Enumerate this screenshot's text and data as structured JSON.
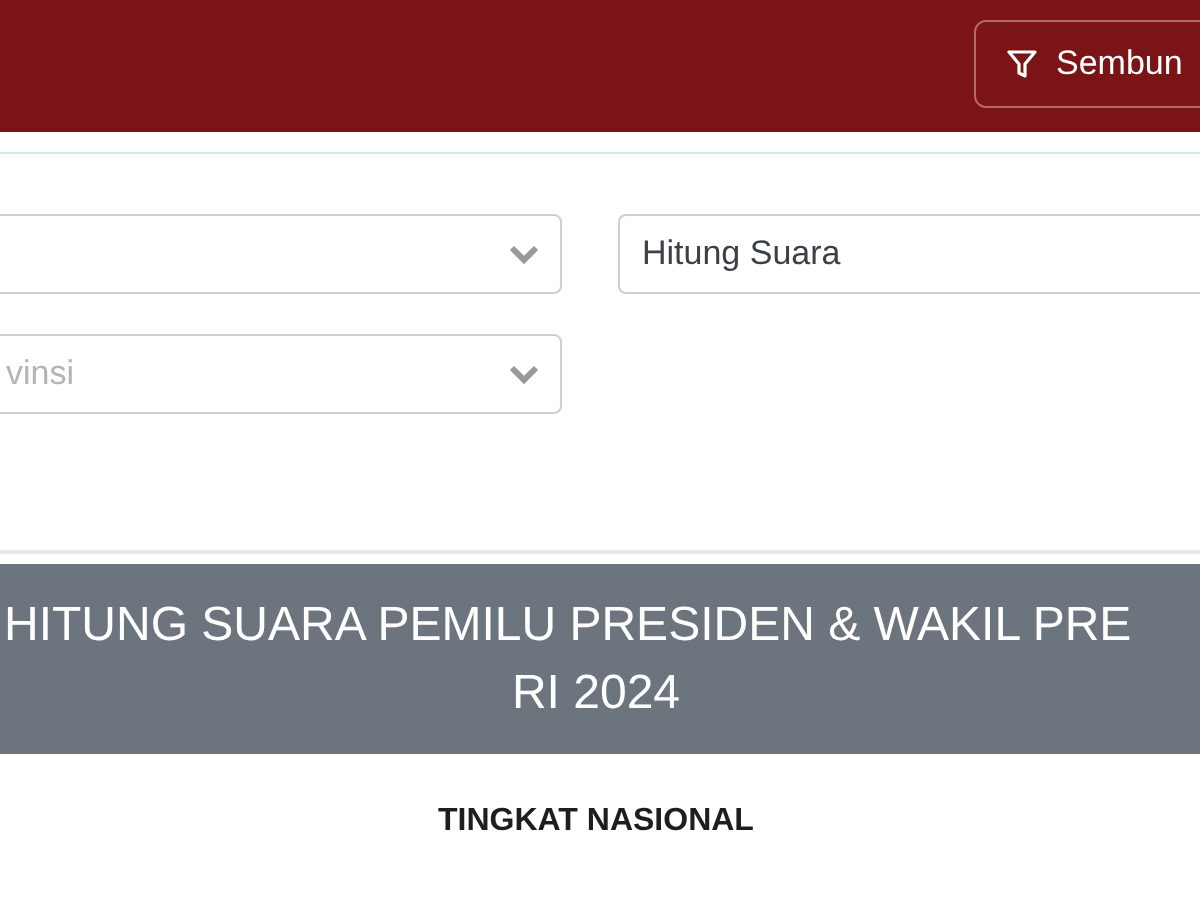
{
  "header": {
    "filter_button": {
      "label": "Sembun"
    }
  },
  "filters": [
    {
      "kind": "select"
    },
    {
      "kind": "text",
      "value": "Hitung Suara"
    },
    {
      "kind": "select",
      "placeholder": "vinsi"
    }
  ],
  "banner": {
    "lines": [
      "HITUNG SUARA PEMILU PRESIDEN & WAKIL PRE",
      "RI 2024"
    ]
  },
  "subheading": "TINGKAT NASIONAL"
}
